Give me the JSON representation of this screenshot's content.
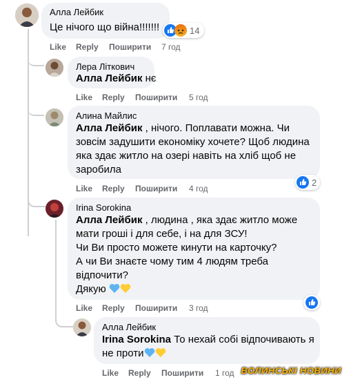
{
  "comments": [
    {
      "author": "Алла Лейбик",
      "text": "Це нічого що війна!!!!!!!",
      "actions": {
        "like": "Like",
        "reply": "Reply",
        "share": "Поширити",
        "time": "7 год"
      },
      "reactions": {
        "count": "14",
        "icons": [
          "like-icon",
          "angry-icon"
        ]
      }
    },
    {
      "author": "Лера Літкович",
      "mention": "Алла Лейбик",
      "text": " нє",
      "actions": {
        "like": "Like",
        "reply": "Reply",
        "share": "Поширити",
        "time": "5 год"
      }
    },
    {
      "author": "Алина Майлис",
      "mention": "Алла Лейбик",
      "text_first": " , нічого. Поплавати можна. Чи",
      "text_rest": "зовсім задушити економіку хочете? Щоб людина\nяка здає житло на озері навіть на хліб щоб не\nзаробила",
      "actions": {
        "like": "Like",
        "reply": "Reply",
        "share": "Поширити",
        "time": "4 год"
      },
      "reactions": {
        "count": "2",
        "icons": [
          "like-icon"
        ]
      }
    },
    {
      "author": "Irina Sorokina",
      "mention": "Алла Лейбик",
      "text_first": " , людина , яка здає житло може",
      "text_rest": "мати гроші і для себе, і на для ЗСУ!\nЧи Ви просто можете кинути на карточку?\nА чи Ви знаєте чому тим 4 людям треба\nвідпочити?",
      "text_last": "Дякую ",
      "actions": {
        "like": "Like",
        "reply": "Reply",
        "share": "Поширити",
        "time": "3 год"
      },
      "reactions": {
        "icons": [
          "like-icon"
        ]
      }
    },
    {
      "author": "Алла Лейбик",
      "mention": "Irina Sorokina",
      "text_first": " То нехай собі відпочивають я",
      "text_rest": "не проти",
      "actions": {
        "like": "Like",
        "reply": "Reply",
        "share": "Поширити",
        "time": "1 год"
      }
    }
  ],
  "watermark": "ВОЛИНСЬКІ НОВИНИ",
  "colors": {
    "like_blue": "#1877f2",
    "heart_blue": "#5db4f0",
    "heart_yellow": "#ffcc33",
    "angry_orange": "#e9710f"
  }
}
